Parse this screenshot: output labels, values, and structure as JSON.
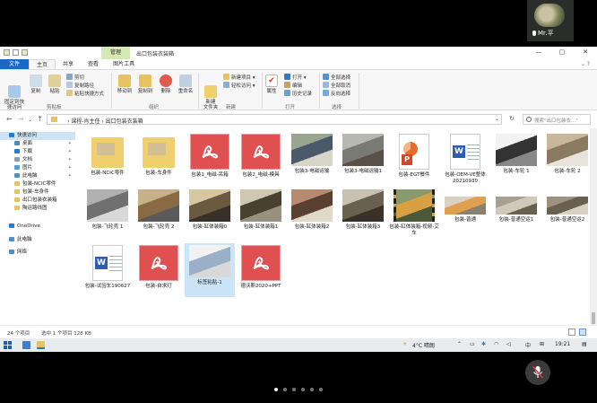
{
  "meeting": {
    "participant_name": "Mr.平"
  },
  "window": {
    "context_tab": "管理",
    "title": "出口包装衣装箱",
    "controls": [
      "—",
      "▢",
      "✕"
    ]
  },
  "ribbon_tabs": [
    "文件",
    "主页",
    "共享",
    "查看",
    "图片工具"
  ],
  "ribbon": {
    "pin_quick": "固定到快\n速访问",
    "copy": "复制",
    "paste": "粘贴",
    "cut": "剪切",
    "copy_path": "复制路径",
    "paste_shortcut": "粘贴快捷方式",
    "move_to": "移动到",
    "copy_to": "复制到",
    "delete": "删除",
    "rename": "重命名",
    "new_item": "新建项目 ▾",
    "easy_access": "轻松访问 ▾",
    "new_folder": "新建\n文件夹",
    "properties": "属性",
    "open": "打开 ▾",
    "edit": "编辑",
    "history": "历史记录",
    "select_all": "全部选择",
    "select_none": "全部取消",
    "invert_selection": "反向选择",
    "groups": {
      "clipboard": "剪贴板",
      "organize": "组织",
      "new": "新建",
      "open": "打开",
      "select": "选择"
    }
  },
  "address": {
    "path": "› 课程-肖主任 › 出口包装衣装箱",
    "search_placeholder": "搜索\"出口包装衣...\""
  },
  "nav": {
    "items": [
      {
        "label": "快速访问",
        "icon": "star-icon",
        "color": "#2b79d1",
        "pinned": false
      },
      {
        "label": "桌面",
        "icon": "desktop-icon",
        "color": "#3a8fd6",
        "pinned": true
      },
      {
        "label": "下载",
        "icon": "download-icon",
        "color": "#2b79d1",
        "pinned": true
      },
      {
        "label": "文档",
        "icon": "document-icon",
        "color": "#8a9bb0",
        "pinned": true
      },
      {
        "label": "图片",
        "icon": "picture-icon",
        "color": "#4aa0d8",
        "pinned": true
      },
      {
        "label": "此电脑",
        "icon": "computer-icon",
        "color": "#4a90c8",
        "pinned": true
      },
      {
        "label": "包装-NCIC零件",
        "icon": "folder-icon",
        "color": "#e8c25e",
        "pinned": false
      },
      {
        "label": "包装-车身件",
        "icon": "folder-icon",
        "color": "#e8c25e",
        "pinned": false
      },
      {
        "label": "出口包装衣装箱",
        "icon": "folder-icon",
        "color": "#e8c25e",
        "pinned": false
      },
      {
        "label": "陶运路线图",
        "icon": "folder-icon",
        "color": "#e8c25e",
        "pinned": false
      },
      {
        "label": "OneDrive",
        "icon": "cloud-icon",
        "color": "#2b79d1",
        "pinned": false
      },
      {
        "label": "此电脑",
        "icon": "computer-icon",
        "color": "#4a90c8",
        "pinned": false
      },
      {
        "label": "网络",
        "icon": "network-icon",
        "color": "#4a90c8",
        "pinned": false
      }
    ]
  },
  "files": [
    {
      "label": "包装-NCIC零件",
      "kind": "folder"
    },
    {
      "label": "包装-车身件",
      "kind": "folder"
    },
    {
      "label": "包装1_电磁-吊箱",
      "kind": "pdf"
    },
    {
      "label": "包装2_电磁-模具",
      "kind": "pdf"
    },
    {
      "label": "包装3-电磁运输",
      "kind": "photo",
      "colors": [
        "#9aa58f",
        "#4a5a6a",
        "#d8d4c8"
      ]
    },
    {
      "label": "包装3-电磁运输1",
      "kind": "photo",
      "colors": [
        "#b8b8b0",
        "#7a7a74",
        "#5a5048"
      ]
    },
    {
      "label": "包装-EGT餐件",
      "kind": "ppt"
    },
    {
      "label": "包装-OEM-VE整体20210930",
      "kind": "word"
    },
    {
      "label": "包装-车轮 1",
      "kind": "photo",
      "colors": [
        "#f2f2f2",
        "#333333",
        "#888888"
      ]
    },
    {
      "label": "包装-车轮 2",
      "kind": "photo",
      "colors": [
        "#c9b79a",
        "#8a7a62",
        "#e8e4dc"
      ]
    },
    {
      "label": "包装-飞轮壳 1",
      "kind": "photo",
      "colors": [
        "#b0b0b0",
        "#707070",
        "#d8d8d8"
      ]
    },
    {
      "label": "包装-飞轮壳 2",
      "kind": "photo",
      "colors": [
        "#c8b08a",
        "#8a6a42",
        "#5a5a5a"
      ]
    },
    {
      "label": "包装-缸体装箱0",
      "kind": "photo",
      "colors": [
        "#d8c6a0",
        "#6a5a40",
        "#3a3028"
      ]
    },
    {
      "label": "包装-缸体装箱1",
      "kind": "photo",
      "colors": [
        "#cfc8b0",
        "#4a4030",
        "#9a9080"
      ]
    },
    {
      "label": "包装-缸体装箱2",
      "kind": "photo",
      "colors": [
        "#b88a70",
        "#5a4030",
        "#e0d8c8"
      ]
    },
    {
      "label": "包装-缸体装箱3",
      "kind": "photo",
      "colors": [
        "#c8c0b0",
        "#6a6050",
        "#3a3028"
      ]
    },
    {
      "label": "包装-缸体装箱-视频-艾车",
      "kind": "video",
      "colors": [
        "#8a9a6a",
        "#d8a040",
        "#4a5a3a"
      ]
    },
    {
      "label": "包装-普通",
      "kind": "photo",
      "colors": [
        "#d8d0c0",
        "#e0a050",
        "#8a8070"
      ]
    },
    {
      "label": "包装-普通空运1",
      "kind": "photo",
      "colors": [
        "#a8a090",
        "#d0c8b8",
        "#6a6050"
      ]
    },
    {
      "label": "包装-普通空运2",
      "kind": "photo",
      "colors": [
        "#a09080",
        "#6a6050",
        "#d8d0c0"
      ]
    },
    {
      "label": "包装-试验车190627",
      "kind": "word"
    },
    {
      "label": "包装-自求灯",
      "kind": "pdf"
    },
    {
      "label": "标签粘贴-1",
      "kind": "photo",
      "colors": [
        "#f2f2f2",
        "#9ab0c8",
        "#d8d8d8"
      ],
      "selected": true
    },
    {
      "label": "德沃斯2020+PPT",
      "kind": "pdf"
    }
  ],
  "status": {
    "count": "24 个项目",
    "selection": "选中 1 个项目  128 KB"
  },
  "taskbar": {
    "weather": "4°C 晴朗",
    "ime": "中",
    "clock": "19:21"
  }
}
